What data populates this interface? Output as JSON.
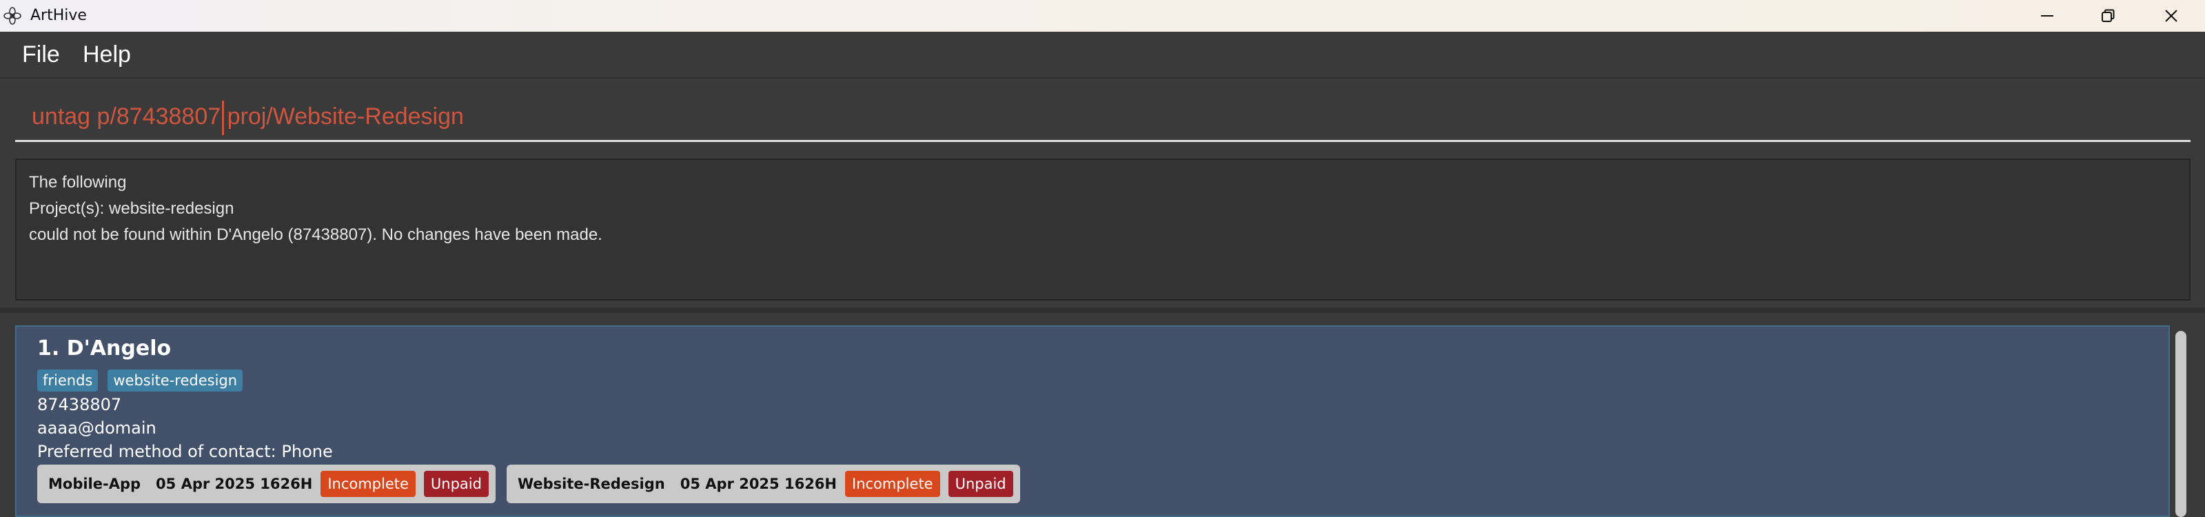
{
  "window": {
    "title": "ArtHive",
    "icon": "flower-icon"
  },
  "menu": {
    "file": "File",
    "help": "Help"
  },
  "command": {
    "value": "untag p/87438807 proj/Website-Redesign"
  },
  "result": {
    "lines": [
      "The following",
      "Project(s): website-redesign",
      "could not be found within D'Angelo (87438807). No changes have been made."
    ]
  },
  "persons": [
    {
      "name": "1. D'Angelo",
      "tags": [
        "friends",
        "website-redesign"
      ],
      "phone": "87438807",
      "email": "aaaa@domain",
      "contact": "Preferred method of contact: Phone",
      "projects": [
        {
          "name": "Mobile-App",
          "date": "05 Apr 2025 1626H",
          "status": "Incomplete",
          "payment": "Unpaid"
        },
        {
          "name": "Website-Redesign",
          "date": "05 Apr 2025 1626H",
          "status": "Incomplete",
          "payment": "Unpaid"
        }
      ]
    }
  ],
  "colors": {
    "command_text": "#d0553f",
    "tag_bg": "#3e7ea3",
    "incomplete": "#d9471d",
    "unpaid": "#a11f27",
    "card_bg": "#43506a"
  }
}
